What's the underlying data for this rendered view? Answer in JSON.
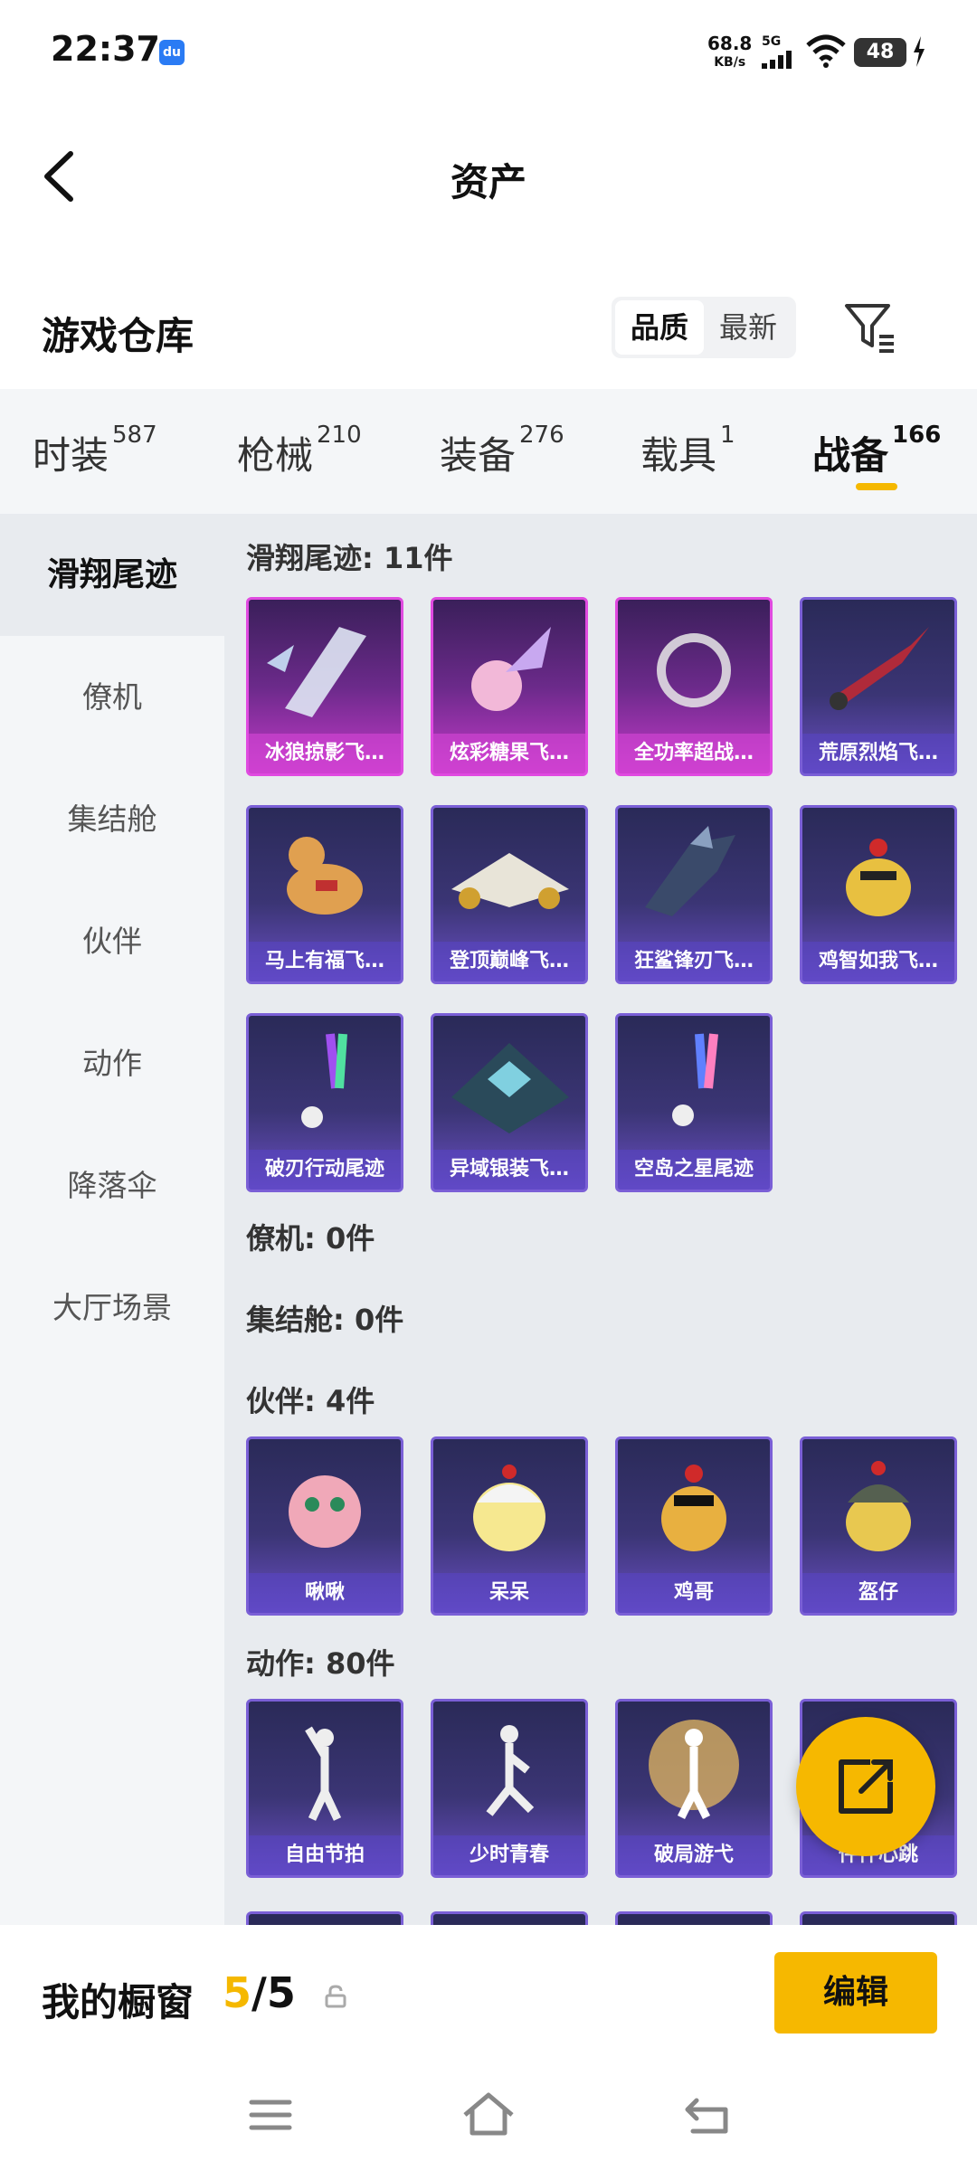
{
  "status_bar": {
    "time": "22:37",
    "app_badge": "du",
    "speed_value": "68.8",
    "speed_unit": "KB/s",
    "network": "5G",
    "battery": "48"
  },
  "header": {
    "title": "资产"
  },
  "section": {
    "title": "游戏仓库",
    "sort_options": [
      "品质",
      "最新"
    ]
  },
  "tabs": [
    {
      "label": "时装",
      "count": "587"
    },
    {
      "label": "枪械",
      "count": "210"
    },
    {
      "label": "装备",
      "count": "276"
    },
    {
      "label": "载具",
      "count": "1"
    },
    {
      "label": "战备",
      "count": "166"
    }
  ],
  "active_tab": "战备",
  "sidebar": {
    "items": [
      "滑翔尾迹",
      "僚机",
      "集结舱",
      "伙伴",
      "动作",
      "降落伞",
      "大厅场景"
    ]
  },
  "groups": {
    "glide": {
      "title": "滑翔尾迹: 11件",
      "items": [
        "冰狼掠影飞…",
        "炫彩糖果飞…",
        "全功率超战…",
        "荒原烈焰飞…",
        "马上有福飞…",
        "登顶巅峰飞…",
        "狂鲨锋刃飞…",
        "鸡智如我飞…",
        "破刃行动尾迹",
        "异域银装飞…",
        "空岛之星尾迹"
      ]
    },
    "wingman": {
      "title": "僚机: 0件"
    },
    "pod": {
      "title": "集结舱: 0件"
    },
    "partner": {
      "title": "伙伴: 4件",
      "items": [
        "啾啾",
        "呆呆",
        "鸡哥",
        "盔仔"
      ]
    },
    "emote": {
      "title": "动作: 80件",
      "items": [
        "自由节拍",
        "少时青春",
        "破局游弋",
        "怦怦心跳"
      ]
    }
  },
  "bottom_bar": {
    "title": "我的橱窗",
    "current": "5",
    "separator": "/",
    "total": "5",
    "edit_label": "编辑"
  },
  "colors": {
    "accent": "#f6b800",
    "card_purple": "#7a5fd6",
    "card_pink": "#e04ae0"
  }
}
